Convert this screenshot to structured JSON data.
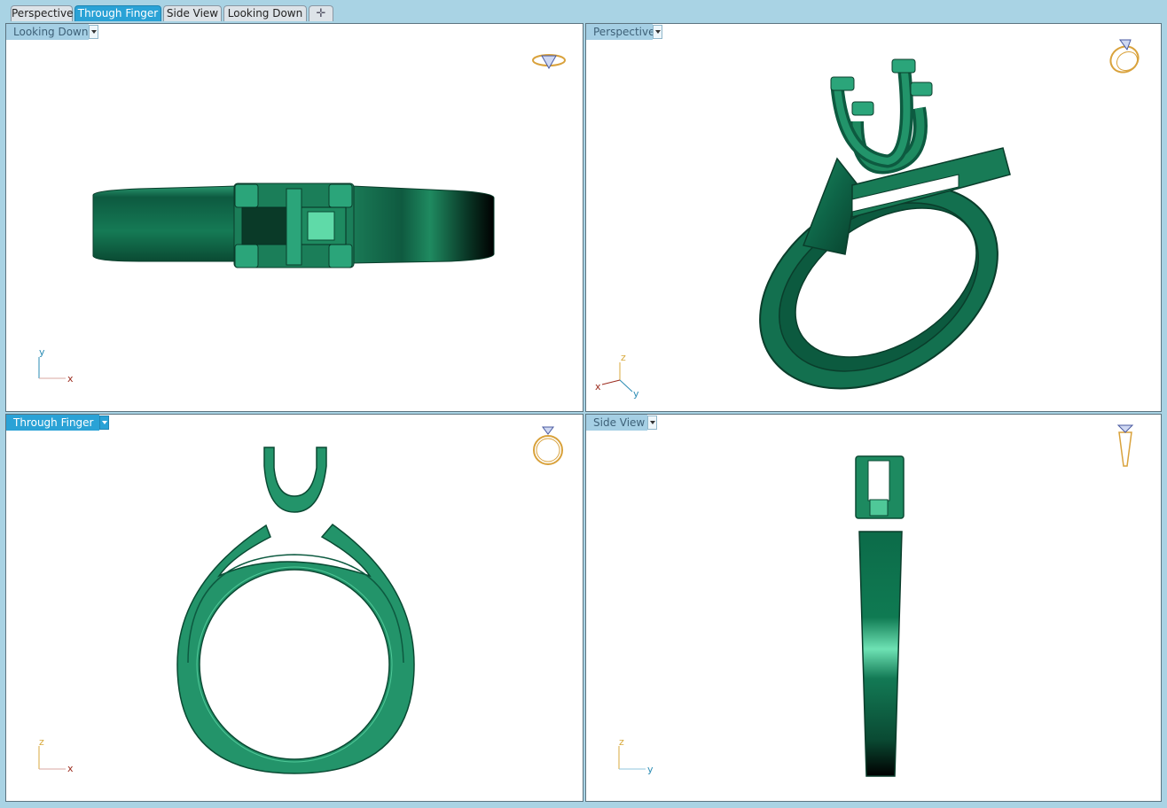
{
  "tabs": [
    {
      "label": "Perspective",
      "active": false
    },
    {
      "label": "Through Finger",
      "active": true
    },
    {
      "label": "Side View",
      "active": false
    },
    {
      "label": "Looking Down",
      "active": false
    }
  ],
  "add_tab_icon": "plus-icon",
  "viewports": {
    "top_left": {
      "label": "Looking Down",
      "axis_a": "y",
      "axis_b": "x"
    },
    "top_right": {
      "label": "Perspective",
      "axis_a": "z",
      "axis_b": "x",
      "axis_c": "y"
    },
    "bottom_left": {
      "label": "Through Finger",
      "axis_a": "z",
      "axis_b": "x"
    },
    "bottom_right": {
      "label": "Side View",
      "axis_a": "z",
      "axis_b": "y"
    }
  },
  "colors": {
    "model": "#1f8a60",
    "model_dark": "#0b4a33",
    "model_light": "#5ad6a6",
    "active_tab": "#2aa2d6",
    "background": "#a9d3e4",
    "axis_x": "#9b2a1c",
    "axis_y": "#2a8bb3",
    "axis_z": "#d8a93c"
  },
  "icons": {
    "view_cube": "ring-orientation-icon",
    "dropdown": "chevron-down-icon"
  }
}
